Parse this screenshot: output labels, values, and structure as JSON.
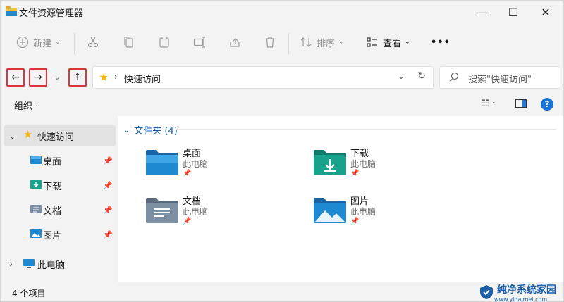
{
  "window": {
    "title": "文件资源管理器",
    "controls": {
      "minimize": "—",
      "maximize": "☐",
      "close": "✕"
    }
  },
  "toolbar": {
    "new_label": "新建",
    "sort_label": "排序",
    "view_label": "查看",
    "more_label": "•••"
  },
  "nav": {
    "back": "←",
    "forward": "→",
    "history": "⌄",
    "up": "↑",
    "path_chevron": "›",
    "path": "快速访问",
    "search_placeholder": "搜索\"快速访问\""
  },
  "org": {
    "label": "组织 ·",
    "help": "?"
  },
  "sidebar": {
    "items": [
      {
        "label": "快速访问",
        "expanded": true,
        "selected": true
      },
      {
        "label": "桌面",
        "pinned": true
      },
      {
        "label": "下载",
        "pinned": true
      },
      {
        "label": "文档",
        "pinned": true
      },
      {
        "label": "图片",
        "pinned": true
      },
      {
        "label": "此电脑",
        "expanded": false
      }
    ]
  },
  "content": {
    "group_header": "文件夹 (4)",
    "tiles": [
      {
        "name": "桌面",
        "sub": "此电脑"
      },
      {
        "name": "下载",
        "sub": "此电脑"
      },
      {
        "name": "文档",
        "sub": "此电脑"
      },
      {
        "name": "图片",
        "sub": "此电脑"
      }
    ]
  },
  "status": {
    "count": "4 个项目"
  },
  "watermark": {
    "text": "纯净系统家园",
    "url": "www.yidaimei.com"
  },
  "colors": {
    "accent": "#1a73d6",
    "highlight": "#d9363e",
    "star": "#f5b400",
    "folder_blue": "#1e88d0",
    "folder_teal": "#1aa38c"
  }
}
